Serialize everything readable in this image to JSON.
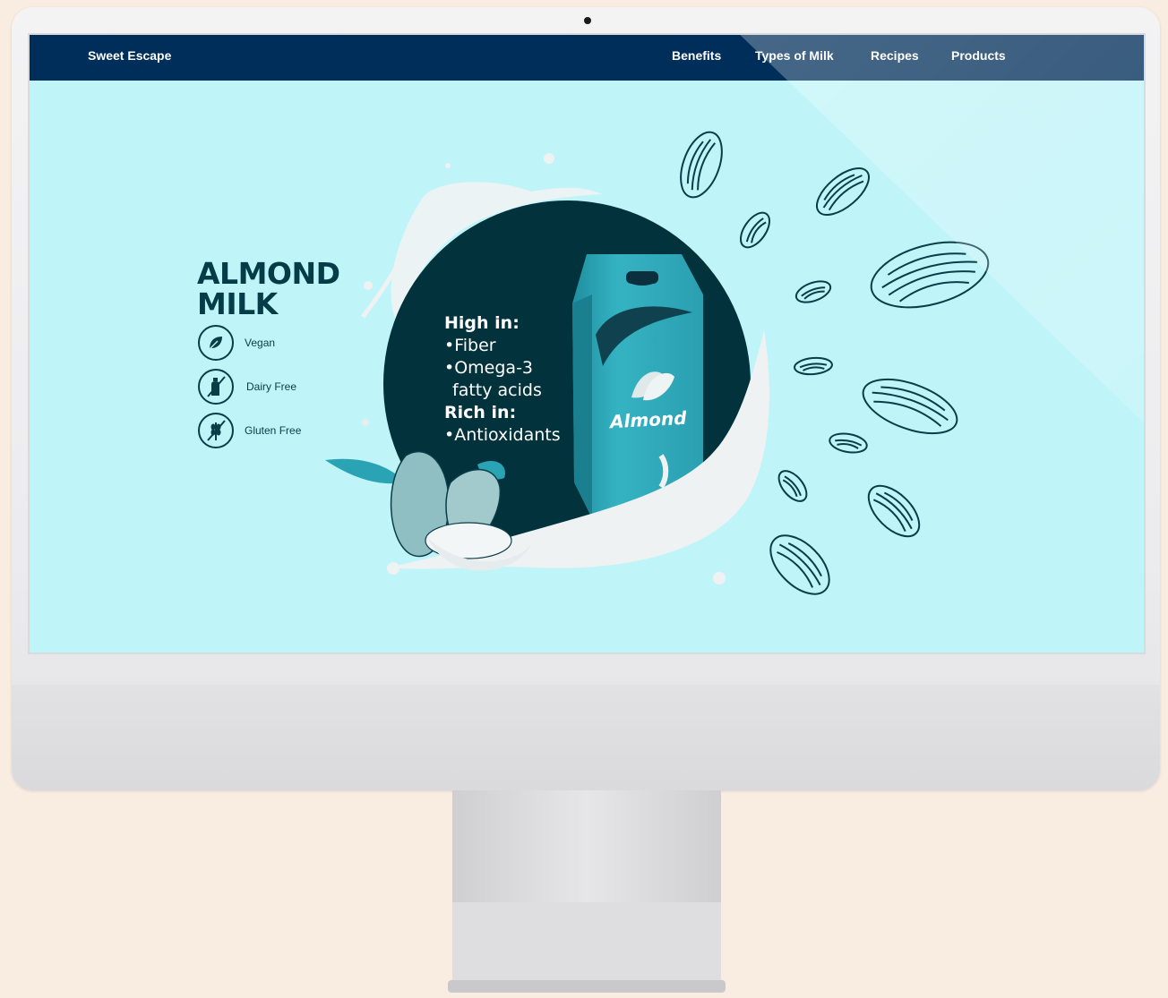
{
  "site": {
    "brand": "Sweet Escape",
    "nav": [
      "Benefits",
      "Types of Milk",
      "Recipes",
      "Products"
    ]
  },
  "hero": {
    "title_line1": "ALMOND",
    "title_line2": "MILK",
    "badges": [
      {
        "label": "Vegan",
        "icon": "leaf-icon"
      },
      {
        "label": "Dairy Free",
        "icon": "no-bottle-icon"
      },
      {
        "label": "Gluten Free",
        "icon": "no-wheat-icon"
      }
    ],
    "facts": {
      "high_header": "High in:",
      "high_items": [
        "•Fiber",
        "•Omega-3",
        "fatty acids"
      ],
      "rich_header": "Rich in:",
      "rich_items": [
        "•Antioxidants"
      ]
    },
    "carton_label": "Almond"
  },
  "colors": {
    "navbar": "#002e5a",
    "screen_bg": "#bff4f8",
    "dark_circle": "#02323c",
    "title": "#063c48",
    "carton": "#2aa3b4"
  }
}
